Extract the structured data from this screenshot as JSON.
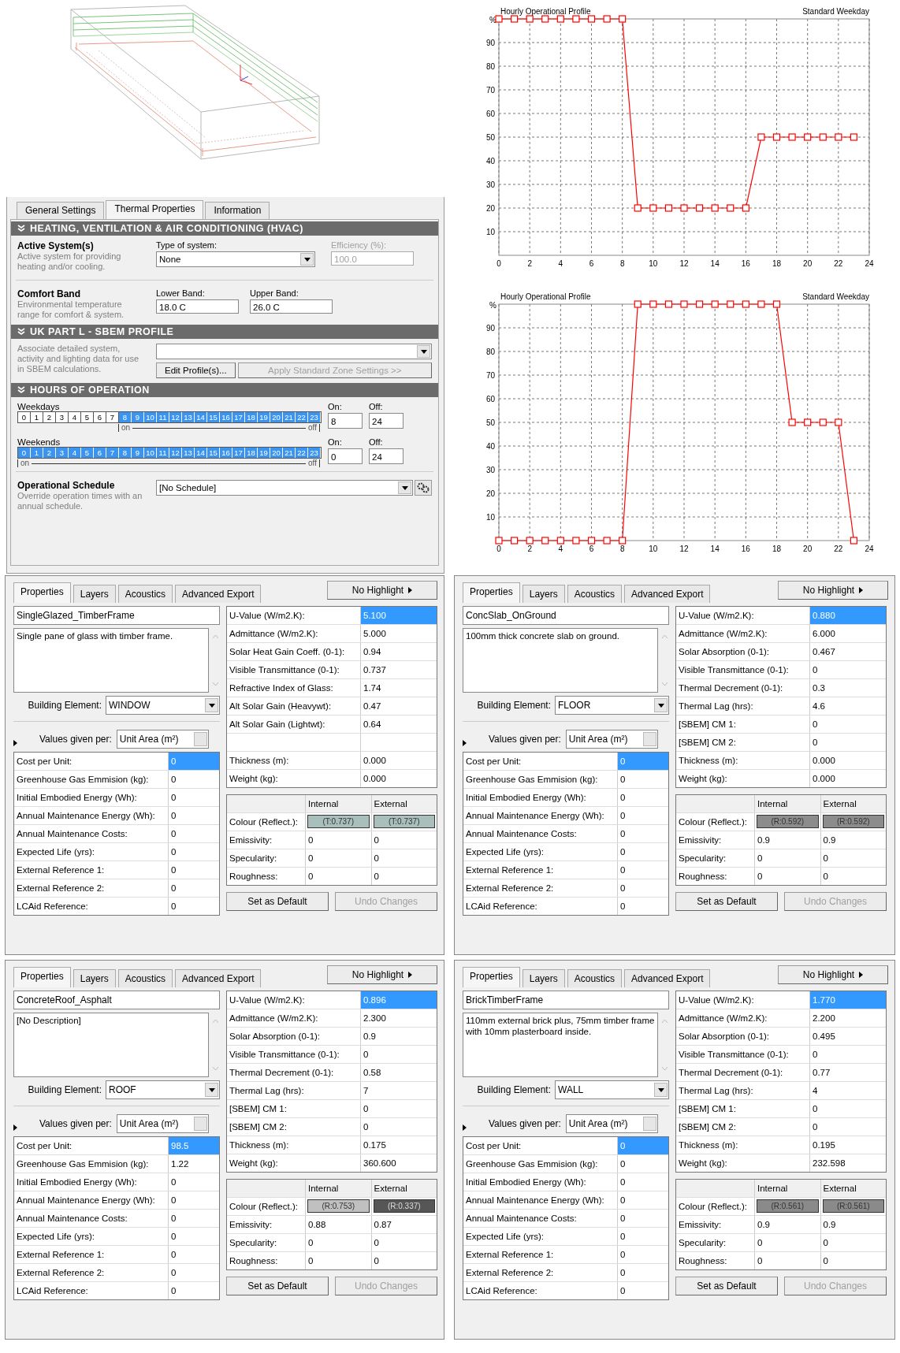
{
  "zone_panel": {
    "tabs": [
      {
        "label": "General Settings",
        "selected": false
      },
      {
        "label": "Thermal Properties",
        "selected": true
      },
      {
        "label": "Information",
        "selected": false
      }
    ],
    "hvac": {
      "title": "HEATING, VENTILATION & AIR CONDITIONING (HVAC)",
      "active_heading": "Active System(s)",
      "active_description": "Active system for providing heating and/or cooling.",
      "type_label": "Type of system:",
      "type_value": "None",
      "efficiency_label": "Efficiency (%):",
      "efficiency_value": "100.0",
      "efficiency_disabled": true,
      "comfort_heading": "Comfort Band",
      "comfort_description": "Environmental temperature range for comfort & system.",
      "lower_label": "Lower Band:",
      "lower_value": "18.0 C",
      "upper_label": "Upper Band:",
      "upper_value": "26.0 C"
    },
    "sbem": {
      "title": "UK PART L - SBEM PROFILE",
      "description": "Associate detailed system, activity and lighting data for use in SBEM calculations.",
      "buttons": [
        {
          "label": "Edit Profile(s)...",
          "disabled": false
        },
        {
          "label": "Apply Standard Zone Settings >>",
          "disabled": true
        }
      ]
    },
    "hours": {
      "title": "HOURS OF OPERATION",
      "schedules": [
        {
          "label": "Weekdays",
          "on_label": "On:",
          "on_value": "8",
          "off_label": "Off:",
          "off_value": "24",
          "range_start": "on",
          "range_end": "off",
          "hours": [
            {
              "label": "0",
              "selected": false
            },
            {
              "label": "1",
              "selected": false
            },
            {
              "label": "2",
              "selected": false
            },
            {
              "label": "3",
              "selected": false
            },
            {
              "label": "4",
              "selected": false
            },
            {
              "label": "5",
              "selected": false
            },
            {
              "label": "6",
              "selected": false
            },
            {
              "label": "7",
              "selected": false
            },
            {
              "label": "8",
              "selected": true
            },
            {
              "label": "9",
              "selected": true
            },
            {
              "label": "10",
              "selected": true
            },
            {
              "label": "11",
              "selected": true
            },
            {
              "label": "12",
              "selected": true
            },
            {
              "label": "13",
              "selected": true
            },
            {
              "label": "14",
              "selected": true
            },
            {
              "label": "15",
              "selected": true
            },
            {
              "label": "16",
              "selected": true
            },
            {
              "label": "17",
              "selected": true
            },
            {
              "label": "18",
              "selected": true
            },
            {
              "label": "19",
              "selected": true
            },
            {
              "label": "20",
              "selected": true
            },
            {
              "label": "21",
              "selected": true
            },
            {
              "label": "22",
              "selected": true
            },
            {
              "label": "23",
              "selected": true
            }
          ]
        },
        {
          "label": "Weekends",
          "on_label": "On:",
          "on_value": "0",
          "off_label": "Off:",
          "off_value": "24",
          "range_start": "on",
          "range_end": "off",
          "hours": [
            {
              "label": "0",
              "selected": true
            },
            {
              "label": "1",
              "selected": true
            },
            {
              "label": "2",
              "selected": true
            },
            {
              "label": "3",
              "selected": true
            },
            {
              "label": "4",
              "selected": true
            },
            {
              "label": "5",
              "selected": true
            },
            {
              "label": "6",
              "selected": true
            },
            {
              "label": "7",
              "selected": true
            },
            {
              "label": "8",
              "selected": true
            },
            {
              "label": "9",
              "selected": true
            },
            {
              "label": "10",
              "selected": true
            },
            {
              "label": "11",
              "selected": true
            },
            {
              "label": "12",
              "selected": true
            },
            {
              "label": "13",
              "selected": true
            },
            {
              "label": "14",
              "selected": true
            },
            {
              "label": "15",
              "selected": true
            },
            {
              "label": "16",
              "selected": true
            },
            {
              "label": "17",
              "selected": true
            },
            {
              "label": "18",
              "selected": true
            },
            {
              "label": "19",
              "selected": true
            },
            {
              "label": "20",
              "selected": true
            },
            {
              "label": "21",
              "selected": true
            },
            {
              "label": "22",
              "selected": true
            },
            {
              "label": "23",
              "selected": true
            }
          ]
        }
      ]
    },
    "schedule": {
      "heading": "Operational Schedule",
      "description": "Override operation times with an annual schedule.",
      "value": "[No Schedule]"
    }
  },
  "charts": [
    {
      "chart_data": {
        "type": "line",
        "title": "Hourly Operational Profile",
        "ylabel": "%",
        "x": [
          0,
          1,
          2,
          3,
          4,
          5,
          6,
          7,
          8,
          9,
          10,
          11,
          12,
          13,
          14,
          15,
          16,
          17,
          18,
          19,
          20,
          21,
          22,
          23
        ],
        "series": [
          {
            "color": "#ff0000",
            "marker": "square",
            "values": [
              100,
              100,
              100,
              100,
              100,
              100,
              100,
              100,
              100,
              20,
              20,
              20,
              20,
              20,
              20,
              20,
              20,
              50,
              50,
              50,
              50,
              50,
              50,
              50
            ]
          }
        ],
        "grid": true,
        "xlim": [
          0,
          24
        ],
        "ylim": [
          0,
          100
        ],
        "xticks": [
          0,
          2,
          4,
          6,
          8,
          10,
          12,
          14,
          16,
          18,
          20,
          22,
          24
        ],
        "yticks": [
          10,
          20,
          30,
          40,
          50,
          60,
          70,
          80,
          90
        ],
        "annotations": [
          {
            "text": "Standard Weekday"
          }
        ]
      }
    },
    {
      "chart_data": {
        "type": "line",
        "title": "Hourly Operational Profile",
        "ylabel": "%",
        "x": [
          0,
          1,
          2,
          3,
          4,
          5,
          6,
          7,
          8,
          9,
          10,
          11,
          12,
          13,
          14,
          15,
          16,
          17,
          18,
          19,
          20,
          21,
          22,
          23
        ],
        "series": [
          {
            "color": "#ff0000",
            "marker": "square",
            "values": [
              0,
              0,
              0,
              0,
              0,
              0,
              0,
              0,
              0,
              100,
              100,
              100,
              100,
              100,
              100,
              100,
              100,
              100,
              100,
              50,
              50,
              50,
              50,
              0
            ]
          }
        ],
        "grid": true,
        "xlim": [
          0,
          24
        ],
        "ylim": [
          0,
          100
        ],
        "xticks": [
          0,
          2,
          4,
          6,
          8,
          10,
          12,
          14,
          16,
          18,
          20,
          22,
          24
        ],
        "yticks": [
          10,
          20,
          30,
          40,
          50,
          60,
          70,
          80,
          90
        ],
        "annotations": [
          {
            "text": "Standard Weekday"
          }
        ]
      }
    }
  ],
  "materials": [
    {
      "tabs": [
        {
          "label": "Properties",
          "selected": true
        },
        {
          "label": "Layers",
          "selected": false
        },
        {
          "label": "Acoustics",
          "selected": false
        },
        {
          "label": "Advanced Export",
          "selected": false
        }
      ],
      "highlight_button": "No Highlight",
      "name": "SingleGlazed_TimberFrame",
      "description": "Single pane of glass with timber frame.",
      "element_label": "Building Element:",
      "element_value": "WINDOW",
      "per_label": "Values given per:",
      "per_value": "Unit Area (m²)",
      "cost_rows": [
        {
          "label": "Cost per Unit:",
          "value": "0",
          "selected": true
        },
        {
          "label": "Greenhouse Gas Emmision (kg):",
          "value": "0",
          "selected": false
        },
        {
          "label": "Initial Embodied Energy (Wh):",
          "value": "0",
          "selected": false
        },
        {
          "label": "Annual Maintenance Energy (Wh):",
          "value": "0",
          "selected": false
        },
        {
          "label": "Annual Maintenance Costs:",
          "value": "0",
          "selected": false
        },
        {
          "label": "Expected Life (yrs):",
          "value": "0",
          "selected": false
        },
        {
          "label": "External Reference 1:",
          "value": "0",
          "selected": false
        },
        {
          "label": "External Reference 2:",
          "value": "0",
          "selected": false
        },
        {
          "label": "LCAid Reference:",
          "value": "0",
          "selected": false
        }
      ],
      "thermal_rows": [
        {
          "kind": "value",
          "label": "U-Value (W/m2.K):",
          "value": "5.100",
          "selected": true
        },
        {
          "kind": "value",
          "label": "Admittance (W/m2.K):",
          "value": "5.000",
          "selected": false
        },
        {
          "kind": "value",
          "label": "Solar Heat Gain Coeff. (0-1):",
          "value": "0.94",
          "selected": false
        },
        {
          "kind": "value",
          "label": "Visible Transmittance (0-1):",
          "value": "0.737",
          "selected": false
        },
        {
          "kind": "value",
          "label": "Refractive Index of Glass:",
          "value": "1.74",
          "selected": false
        },
        {
          "kind": "value",
          "label": "Alt Solar Gain (Heavywt):",
          "value": "0.47",
          "selected": false
        },
        {
          "kind": "value",
          "label": "Alt Solar Gain (Lightwt):",
          "value": "0.64",
          "selected": false
        },
        {
          "kind": "blank"
        },
        {
          "kind": "value",
          "label": "Thickness (m):",
          "value": "0.000",
          "selected": false
        },
        {
          "kind": "value",
          "label": "Weight (kg):",
          "value": "0.000",
          "selected": false
        }
      ],
      "surface_columns": [
        "Internal",
        "External"
      ],
      "surface_rows": [
        {
          "kind": "swatch",
          "label": "Colour (Reflect.):",
          "internal": {
            "text": "(T:0.737)",
            "color": "#a8bfbb"
          },
          "external": {
            "text": "(T:0.737)",
            "color": "#a8bfbb"
          }
        },
        {
          "kind": "text",
          "label": "Emissivity:",
          "internal": "0",
          "external": "0"
        },
        {
          "kind": "text",
          "label": "Specularity:",
          "internal": "0",
          "external": "0"
        },
        {
          "kind": "text",
          "label": "Roughness:",
          "internal": "0",
          "external": "0"
        }
      ],
      "buttons": [
        {
          "label": "Set as Default",
          "disabled": false
        },
        {
          "label": "Undo Changes",
          "disabled": true
        }
      ]
    },
    {
      "tabs": [
        {
          "label": "Properties",
          "selected": true
        },
        {
          "label": "Layers",
          "selected": false
        },
        {
          "label": "Acoustics",
          "selected": false
        },
        {
          "label": "Advanced Export",
          "selected": false
        }
      ],
      "highlight_button": "No Highlight",
      "name": "ConcSlab_OnGround",
      "description": "100mm thick concrete slab on ground.",
      "element_label": "Building Element:",
      "element_value": "FLOOR",
      "per_label": "Values given per:",
      "per_value": "Unit Area (m²)",
      "cost_rows": [
        {
          "label": "Cost per Unit:",
          "value": "0",
          "selected": true
        },
        {
          "label": "Greenhouse Gas Emmision (kg):",
          "value": "0",
          "selected": false
        },
        {
          "label": "Initial Embodied Energy (Wh):",
          "value": "0",
          "selected": false
        },
        {
          "label": "Annual Maintenance Energy (Wh):",
          "value": "0",
          "selected": false
        },
        {
          "label": "Annual Maintenance Costs:",
          "value": "0",
          "selected": false
        },
        {
          "label": "Expected Life (yrs):",
          "value": "0",
          "selected": false
        },
        {
          "label": "External Reference 1:",
          "value": "0",
          "selected": false
        },
        {
          "label": "External Reference 2:",
          "value": "0",
          "selected": false
        },
        {
          "label": "LCAid Reference:",
          "value": "0",
          "selected": false
        }
      ],
      "thermal_rows": [
        {
          "kind": "value",
          "label": "U-Value (W/m2.K):",
          "value": "0.880",
          "selected": true
        },
        {
          "kind": "value",
          "label": "Admittance (W/m2.K):",
          "value": "6.000",
          "selected": false
        },
        {
          "kind": "value",
          "label": "Solar Absorption (0-1):",
          "value": "0.467",
          "selected": false
        },
        {
          "kind": "value",
          "label": "Visible Transmittance (0-1):",
          "value": "0",
          "selected": false
        },
        {
          "kind": "value",
          "label": "Thermal Decrement (0-1):",
          "value": "0.3",
          "selected": false
        },
        {
          "kind": "value",
          "label": "Thermal Lag (hrs):",
          "value": "4.6",
          "selected": false
        },
        {
          "kind": "value",
          "label": "[SBEM] CM 1:",
          "value": "0",
          "selected": false
        },
        {
          "kind": "value",
          "label": "[SBEM] CM 2:",
          "value": "0",
          "selected": false
        },
        {
          "kind": "value",
          "label": "Thickness (m):",
          "value": "0.000",
          "selected": false
        },
        {
          "kind": "value",
          "label": "Weight (kg):",
          "value": "0.000",
          "selected": false
        }
      ],
      "surface_columns": [
        "Internal",
        "External"
      ],
      "surface_rows": [
        {
          "kind": "swatch",
          "label": "Colour (Reflect.):",
          "internal": {
            "text": "(R:0.592)",
            "color": "#8c8c8c"
          },
          "external": {
            "text": "(R:0.592)",
            "color": "#8c8c8c"
          }
        },
        {
          "kind": "text",
          "label": "Emissivity:",
          "internal": "0.9",
          "external": "0.9"
        },
        {
          "kind": "text",
          "label": "Specularity:",
          "internal": "0",
          "external": "0"
        },
        {
          "kind": "text",
          "label": "Roughness:",
          "internal": "0",
          "external": "0"
        }
      ],
      "buttons": [
        {
          "label": "Set as Default",
          "disabled": false
        },
        {
          "label": "Undo Changes",
          "disabled": true
        }
      ]
    },
    {
      "tabs": [
        {
          "label": "Properties",
          "selected": true
        },
        {
          "label": "Layers",
          "selected": false
        },
        {
          "label": "Acoustics",
          "selected": false
        },
        {
          "label": "Advanced Export",
          "selected": false
        }
      ],
      "highlight_button": "No Highlight",
      "name": "ConcreteRoof_Asphalt",
      "description": "[No Description]",
      "element_label": "Building Element:",
      "element_value": "ROOF",
      "per_label": "Values given per:",
      "per_value": "Unit Area (m²)",
      "cost_rows": [
        {
          "label": "Cost per Unit:",
          "value": "98.5",
          "selected": true
        },
        {
          "label": "Greenhouse Gas Emmision (kg):",
          "value": "1.22",
          "selected": false
        },
        {
          "label": "Initial Embodied Energy (Wh):",
          "value": "0",
          "selected": false
        },
        {
          "label": "Annual Maintenance Energy (Wh):",
          "value": "0",
          "selected": false
        },
        {
          "label": "Annual Maintenance Costs:",
          "value": "0",
          "selected": false
        },
        {
          "label": "Expected Life (yrs):",
          "value": "0",
          "selected": false
        },
        {
          "label": "External Reference 1:",
          "value": "0",
          "selected": false
        },
        {
          "label": "External Reference 2:",
          "value": "0",
          "selected": false
        },
        {
          "label": "LCAid Reference:",
          "value": "0",
          "selected": false
        }
      ],
      "thermal_rows": [
        {
          "kind": "value",
          "label": "U-Value (W/m2.K):",
          "value": "0.896",
          "selected": true
        },
        {
          "kind": "value",
          "label": "Admittance (W/m2.K):",
          "value": "2.300",
          "selected": false
        },
        {
          "kind": "value",
          "label": "Solar Absorption (0-1):",
          "value": "0.9",
          "selected": false
        },
        {
          "kind": "value",
          "label": "Visible Transmittance (0-1):",
          "value": "0",
          "selected": false
        },
        {
          "kind": "value",
          "label": "Thermal Decrement (0-1):",
          "value": "0.58",
          "selected": false
        },
        {
          "kind": "value",
          "label": "Thermal Lag (hrs):",
          "value": "7",
          "selected": false
        },
        {
          "kind": "value",
          "label": "[SBEM] CM 1:",
          "value": "0",
          "selected": false
        },
        {
          "kind": "value",
          "label": "[SBEM] CM 2:",
          "value": "0",
          "selected": false
        },
        {
          "kind": "value",
          "label": "Thickness (m):",
          "value": "0.175",
          "selected": false
        },
        {
          "kind": "value",
          "label": "Weight (kg):",
          "value": "360.600",
          "selected": false
        }
      ],
      "surface_columns": [
        "Internal",
        "External"
      ],
      "surface_rows": [
        {
          "kind": "swatch",
          "label": "Colour (Reflect.):",
          "internal": {
            "text": "(R:0.753)",
            "color": "#c0c0c0"
          },
          "external": {
            "text": "(R:0.337)",
            "color": "#565656"
          }
        },
        {
          "kind": "text",
          "label": "Emissivity:",
          "internal": "0.88",
          "external": "0.87"
        },
        {
          "kind": "text",
          "label": "Specularity:",
          "internal": "0",
          "external": "0"
        },
        {
          "kind": "text",
          "label": "Roughness:",
          "internal": "0",
          "external": "0"
        }
      ],
      "buttons": [
        {
          "label": "Set as Default",
          "disabled": false
        },
        {
          "label": "Undo Changes",
          "disabled": true
        }
      ]
    },
    {
      "tabs": [
        {
          "label": "Properties",
          "selected": true
        },
        {
          "label": "Layers",
          "selected": false
        },
        {
          "label": "Acoustics",
          "selected": false
        },
        {
          "label": "Advanced Export",
          "selected": false
        }
      ],
      "highlight_button": "No Highlight",
      "name": "BrickTimberFrame",
      "description": "110mm external brick plus, 75mm timber frame with 10mm plasterboard inside.",
      "element_label": "Building Element:",
      "element_value": "WALL",
      "per_label": "Values given per:",
      "per_value": "Unit Area (m²)",
      "cost_rows": [
        {
          "label": "Cost per Unit:",
          "value": "0",
          "selected": true
        },
        {
          "label": "Greenhouse Gas Emmision (kg):",
          "value": "0",
          "selected": false
        },
        {
          "label": "Initial Embodied Energy (Wh):",
          "value": "0",
          "selected": false
        },
        {
          "label": "Annual Maintenance Energy (Wh):",
          "value": "0",
          "selected": false
        },
        {
          "label": "Annual Maintenance Costs:",
          "value": "0",
          "selected": false
        },
        {
          "label": "Expected Life (yrs):",
          "value": "0",
          "selected": false
        },
        {
          "label": "External Reference 1:",
          "value": "0",
          "selected": false
        },
        {
          "label": "External Reference 2:",
          "value": "0",
          "selected": false
        },
        {
          "label": "LCAid Reference:",
          "value": "0",
          "selected": false
        }
      ],
      "thermal_rows": [
        {
          "kind": "value",
          "label": "U-Value (W/m2.K):",
          "value": "1.770",
          "selected": true
        },
        {
          "kind": "value",
          "label": "Admittance (W/m2.K):",
          "value": "2.200",
          "selected": false
        },
        {
          "kind": "value",
          "label": "Solar Absorption (0-1):",
          "value": "0.495",
          "selected": false
        },
        {
          "kind": "value",
          "label": "Visible Transmittance (0-1):",
          "value": "0",
          "selected": false
        },
        {
          "kind": "value",
          "label": "Thermal Decrement (0-1):",
          "value": "0.77",
          "selected": false
        },
        {
          "kind": "value",
          "label": "Thermal Lag (hrs):",
          "value": "4",
          "selected": false
        },
        {
          "kind": "value",
          "label": "[SBEM] CM 1:",
          "value": "0",
          "selected": false
        },
        {
          "kind": "value",
          "label": "[SBEM] CM 2:",
          "value": "0",
          "selected": false
        },
        {
          "kind": "value",
          "label": "Thickness (m):",
          "value": "0.195",
          "selected": false
        },
        {
          "kind": "value",
          "label": "Weight (kg):",
          "value": "232.598",
          "selected": false
        }
      ],
      "surface_columns": [
        "Internal",
        "External"
      ],
      "surface_rows": [
        {
          "kind": "swatch",
          "label": "Colour (Reflect.):",
          "internal": {
            "text": "(R:0.561)",
            "color": "#8a8a8a"
          },
          "external": {
            "text": "(R:0.561)",
            "color": "#8a8a8a"
          }
        },
        {
          "kind": "text",
          "label": "Emissivity:",
          "internal": "0.9",
          "external": "0.9"
        },
        {
          "kind": "text",
          "label": "Specularity:",
          "internal": "0",
          "external": "0"
        },
        {
          "kind": "text",
          "label": "Roughness:",
          "internal": "0",
          "external": "0"
        }
      ],
      "buttons": [
        {
          "label": "Set as Default",
          "disabled": false
        },
        {
          "label": "Undo Changes",
          "disabled": true
        }
      ]
    }
  ]
}
